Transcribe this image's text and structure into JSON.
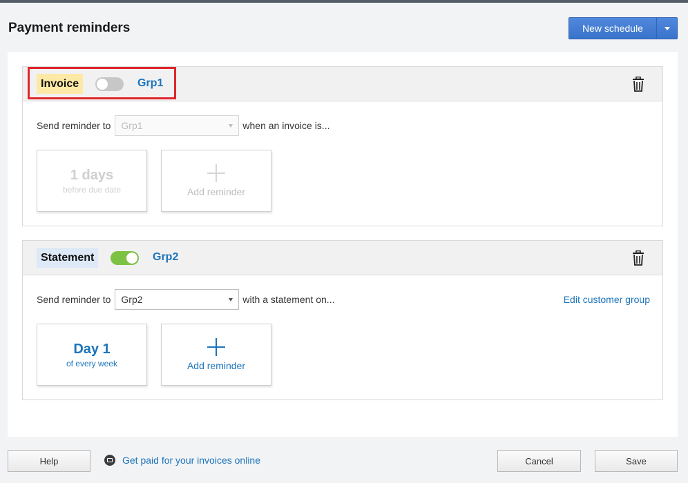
{
  "page": {
    "title": "Payment reminders"
  },
  "header": {
    "new_schedule_label": "New schedule"
  },
  "schedules": [
    {
      "type_label": "Invoice",
      "enabled": false,
      "group": "Grp1",
      "send_prefix": "Send reminder to",
      "selected_group": "Grp1",
      "send_suffix": "when an invoice is...",
      "tiles": [
        {
          "big": "1 days",
          "small": "before due date"
        }
      ],
      "add_label": "Add reminder"
    },
    {
      "type_label": "Statement",
      "enabled": true,
      "group": "Grp2",
      "send_prefix": "Send reminder to",
      "selected_group": "Grp2",
      "send_suffix": "with a statement on...",
      "edit_link": "Edit customer group",
      "tiles": [
        {
          "big": "Day 1",
          "small": "of every week"
        }
      ],
      "add_label": "Add reminder"
    }
  ],
  "footer": {
    "help_label": "Help",
    "paid_link": "Get paid for your invoices online",
    "cancel_label": "Cancel",
    "save_label": "Save"
  },
  "colors": {
    "accent_blue": "#1c74bb",
    "primary_button": "#3a73ca",
    "toggle_on": "#7dc242",
    "toggle_off": "#c7c7c7",
    "invoice_pill": "#fde9a6",
    "statement_pill": "#dde9f7",
    "highlight": "#e0262b"
  },
  "icons": {
    "delete": "trash-icon",
    "dropdown": "chevron-down-icon",
    "add": "plus-icon",
    "payments": "payment-icon"
  }
}
